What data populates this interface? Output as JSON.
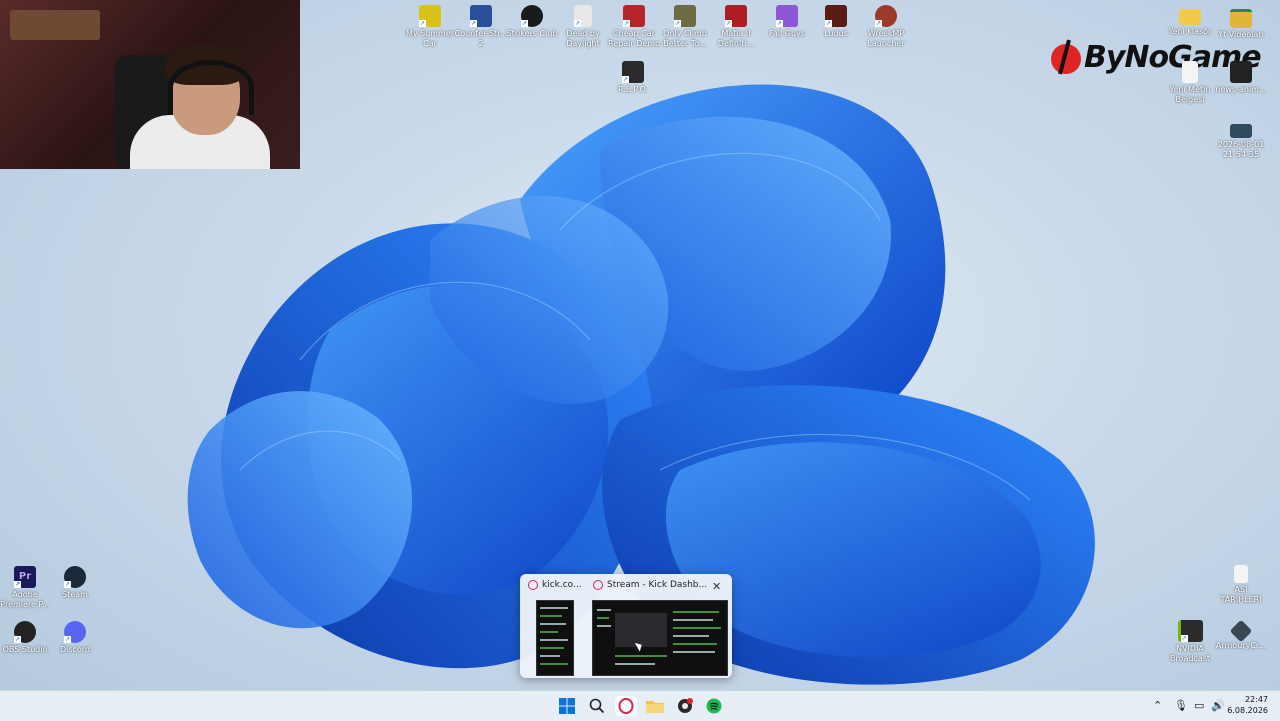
{
  "desktop_icons_top": [
    {
      "label": "My Summer Car",
      "color": "#d9c21a"
    },
    {
      "label": "Counter-Str... 2",
      "color": "#2a4f9a"
    },
    {
      "label": "Strikers Club",
      "color": "#1b1b1b"
    },
    {
      "label": "Dead by Daylight",
      "color": "#e8e8e8"
    },
    {
      "label": "Cheap Car Repair Demo",
      "color": "#b5262b"
    },
    {
      "label": "Only Climb Better To...",
      "color": "#6e6a44"
    },
    {
      "label": "Mafia II Definiti...",
      "color": "#b01c24"
    },
    {
      "label": "Fall Guys",
      "color": "#8d57d6"
    },
    {
      "label": "Ludus",
      "color": "#5a1a16"
    },
    {
      "label": "WreckMP Launcher",
      "color": "#9a3b2a"
    },
    {
      "label": "R.E.P.O.",
      "color": "#2b2b2b"
    }
  ],
  "desktop_icons_right": [
    {
      "label": "Yeni klasör",
      "color": "#f3c94a"
    },
    {
      "label": "Yt Videoları",
      "color": "#e0b63a"
    },
    {
      "label": "Yeni Metin Belgesi",
      "color": "#f4f4f4"
    },
    {
      "label": "news-anim...",
      "color": "#222222"
    },
    {
      "label": "2026-08-01 21-54-35",
      "color": "#2f4a5a"
    },
    {
      "label": "AŞI TARİHLERİ",
      "color": "#f4f4f4"
    },
    {
      "label": "NVIDIA Broadcast",
      "color": "#2b2b2b"
    },
    {
      "label": "ArmouryCr...",
      "color": "#3a4650"
    }
  ],
  "desktop_icons_left": [
    {
      "label": "Adobe Premiere P...",
      "color": "#1b1a5a"
    },
    {
      "label": "Steam",
      "color": "#1b2838"
    },
    {
      "label": "OBS Studio",
      "color": "#222222"
    },
    {
      "label": "Discord",
      "color": "#5865f2"
    }
  ],
  "brand": {
    "text": "ByNoGame",
    "color": "#e02424"
  },
  "preview": {
    "tab1_label": "kick.co...",
    "tab2_label": "Stream - Kick Dashb...",
    "close_label": "✕"
  },
  "taskbar": {
    "start_icon": "windows-start-icon",
    "time": "22:47",
    "date": "6.08.2026"
  }
}
